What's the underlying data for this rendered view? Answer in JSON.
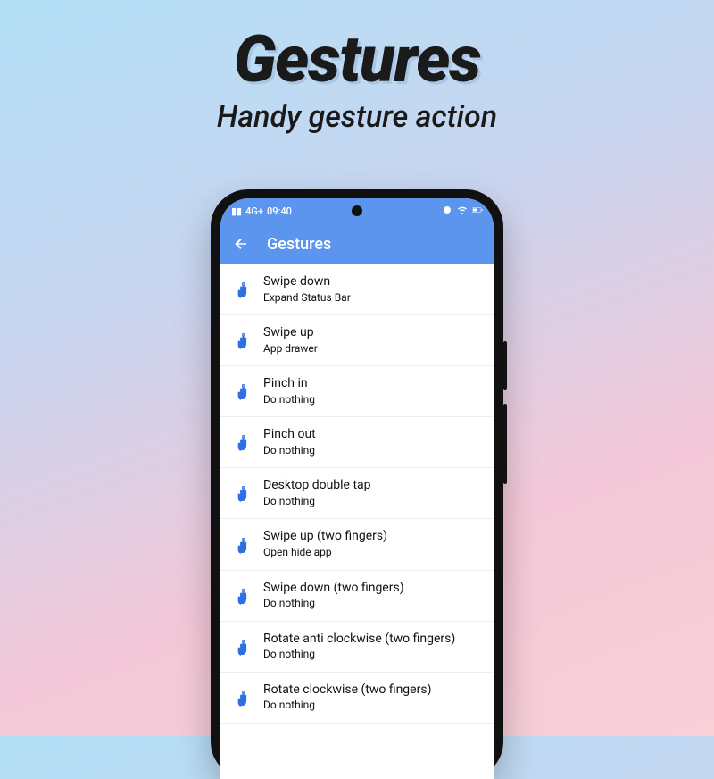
{
  "promo": {
    "title": "Gestures",
    "subtitle": "Handy gesture action"
  },
  "statusbar": {
    "time": "09:40",
    "network_label": "4G+"
  },
  "appbar": {
    "title": "Gestures"
  },
  "gestures": [
    {
      "title": "Swipe down",
      "subtitle": "Expand Status Bar"
    },
    {
      "title": "Swipe up",
      "subtitle": "App drawer"
    },
    {
      "title": "Pinch in",
      "subtitle": "Do nothing"
    },
    {
      "title": "Pinch out",
      "subtitle": "Do nothing"
    },
    {
      "title": "Desktop double tap",
      "subtitle": "Do nothing"
    },
    {
      "title": "Swipe up (two fingers)",
      "subtitle": "Open hide app"
    },
    {
      "title": "Swipe down (two fingers)",
      "subtitle": "Do nothing"
    },
    {
      "title": "Rotate anti clockwise (two fingers)",
      "subtitle": "Do nothing"
    },
    {
      "title": "Rotate clockwise (two fingers)",
      "subtitle": "Do nothing"
    }
  ]
}
